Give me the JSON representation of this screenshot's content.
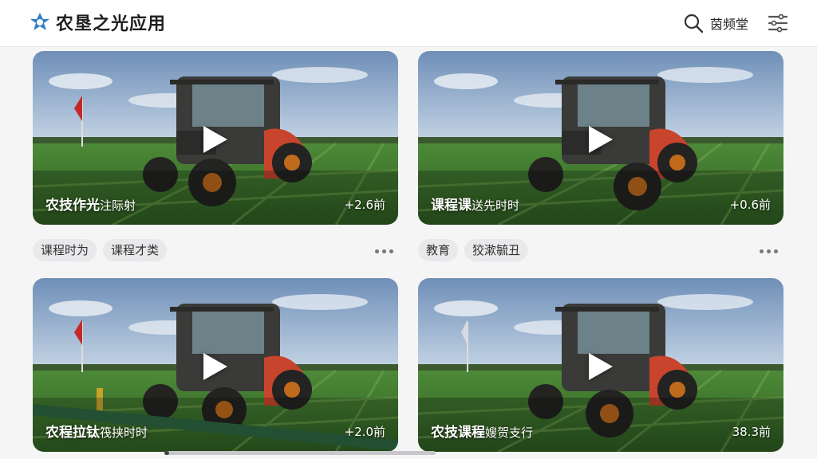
{
  "header": {
    "app_title": "农垦之光应用",
    "search_label": "茵频堂"
  },
  "cards": [
    {
      "title": "农技作光",
      "subtitle": "注际射",
      "meta": "+2.6前"
    },
    {
      "title": "课程课",
      "subtitle": "送先时时",
      "meta": "+0.6前"
    },
    {
      "title": "农程拉钛",
      "subtitle": "筏挟时时",
      "meta": "+2.0前"
    },
    {
      "title": "农技课程",
      "subtitle": "嫂贺支行",
      "meta": "38.3前"
    }
  ],
  "tag_rows": [
    {
      "tags": [
        "课程时为",
        "课程才类"
      ]
    },
    {
      "tags": [
        "教育",
        "狡漱毓丑"
      ]
    }
  ],
  "colors": {
    "sky_top": "#6f8fb8",
    "sky_bottom": "#c7d6e6",
    "field": "#3e7a2c",
    "tractor_fender": "#c8442c",
    "logo_blue": "#2f7fc6"
  }
}
